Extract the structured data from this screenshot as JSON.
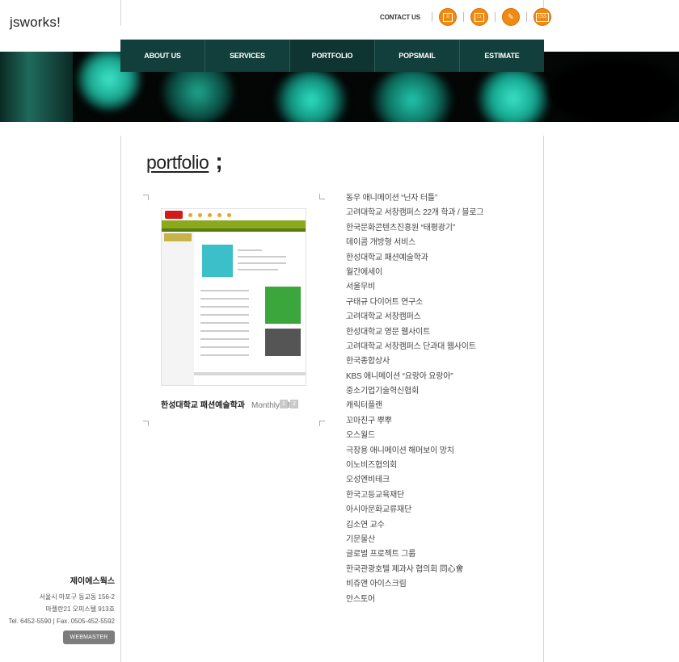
{
  "brand": {
    "logo": "jsworks!"
  },
  "utility": {
    "contact_label": "CONTACT US",
    "icons": [
      "page-icon",
      "tv-icon",
      "pen-icon",
      "ad-icon"
    ],
    "icon_labels": [
      "",
      "",
      "",
      "CSS"
    ],
    "accent": "#f08a12"
  },
  "nav": {
    "items": [
      {
        "label": "ABOUT US"
      },
      {
        "label": "SERVICES"
      },
      {
        "label": "PORTFOLIO"
      },
      {
        "label": "POPSMAIL"
      },
      {
        "label": "ESTIMATE"
      }
    ],
    "active": "PORTFOLIO",
    "color": "#123f3b"
  },
  "page": {
    "title": "portfolio",
    "title_suffix": ";"
  },
  "featured": {
    "title": "한성대학교 패션예술학과",
    "subtitle": "Monthly Elfa",
    "pages": [
      "1",
      "2"
    ]
  },
  "portfolio_list": [
    "동우 애니메이션 “닌자 터틀”",
    "고려대학교 서창캠퍼스 22개 학과 / 블로그",
    "한국문화콘텐츠진흥원 “태평광기”",
    "데이콤 개방형 서비스",
    "한성대학교 패션예술학과",
    "월간에세이",
    "서울무비",
    "구태규 다이어트 연구소",
    "고려대학교 서창캠퍼스",
    "한성대학교 영문 웹사이트",
    "고려대학교 서창캠퍼스 단과대 웹사이트",
    "한국종합상사",
    "KBS 애니메이션 “요랑아 요랑아”",
    "중소기업기술혁신협회",
    "캐릭터플랜",
    "꼬마친구 뿌뿌",
    "오스월드",
    "극장용 애니메이션 해머보이 망치",
    "이노비즈협의회",
    "오성엔비테크",
    "한국고등교육재단",
    "아시아문화교류재단",
    "김소연 교수",
    "기문물산",
    "글로벌 프로젝트 그룹",
    "한국관광호텔 제과사 협의회 同心會",
    "비쥬앤 아이스크림",
    "안스토어"
  ],
  "footer": {
    "company": "제이에스웍스",
    "address1": "서울시 마포구 동교동 156-2",
    "address2": "마젤란21 오피스텔 913호",
    "contact": "Tel. 6452-5590  |  Fax. 0505-452-5592",
    "webmaster_label": "WEBMASTER"
  }
}
